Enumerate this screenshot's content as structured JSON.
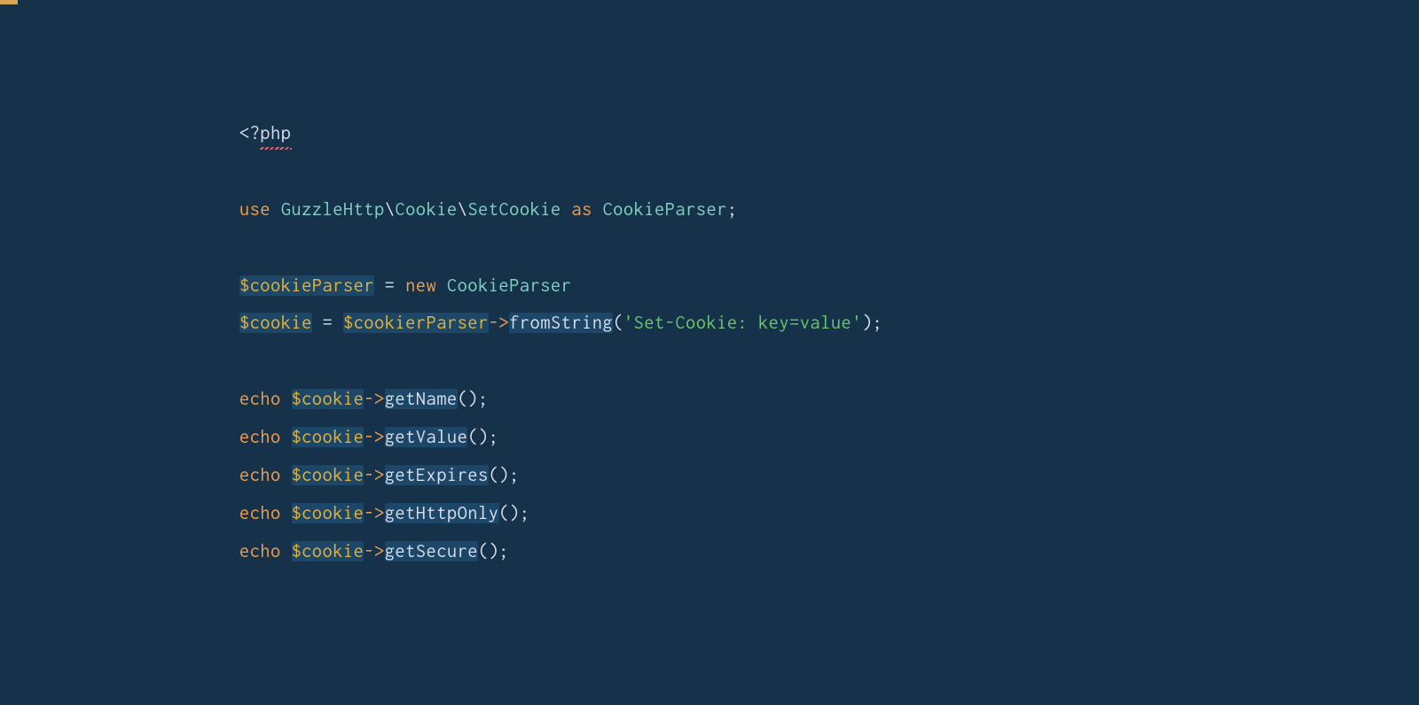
{
  "code": {
    "lines": [
      {
        "tokens": [
          {
            "text": "<?",
            "class": "token-default"
          },
          {
            "text": "php",
            "class": "token-default",
            "squiggle": true
          }
        ]
      },
      {
        "tokens": []
      },
      {
        "tokens": [
          {
            "text": "use",
            "class": "token-keyword"
          },
          {
            "text": " ",
            "class": "token-default"
          },
          {
            "text": "GuzzleHttp",
            "class": "token-class"
          },
          {
            "text": "\\",
            "class": "token-backslash"
          },
          {
            "text": "Cookie",
            "class": "token-class"
          },
          {
            "text": "\\",
            "class": "token-backslash"
          },
          {
            "text": "SetCookie",
            "class": "token-class"
          },
          {
            "text": " ",
            "class": "token-default"
          },
          {
            "text": "as",
            "class": "token-keyword"
          },
          {
            "text": " ",
            "class": "token-default"
          },
          {
            "text": "CookieParser",
            "class": "token-class"
          },
          {
            "text": ";",
            "class": "token-punct"
          }
        ]
      },
      {
        "tokens": []
      },
      {
        "tokens": [
          {
            "text": "$cookieParser",
            "class": "token-variable",
            "hl": true
          },
          {
            "text": " = ",
            "class": "token-operator"
          },
          {
            "text": "new",
            "class": "token-keyword"
          },
          {
            "text": " ",
            "class": "token-default"
          },
          {
            "text": "CookieParser",
            "class": "token-class"
          }
        ]
      },
      {
        "tokens": [
          {
            "text": "$cookie",
            "class": "token-variable",
            "hl": true
          },
          {
            "text": " = ",
            "class": "token-operator"
          },
          {
            "text": "$cookierParser",
            "class": "token-variable",
            "hl": true
          },
          {
            "text": "->",
            "class": "token-arrow"
          },
          {
            "text": "fromString",
            "class": "token-method",
            "hl": true
          },
          {
            "text": "(",
            "class": "token-punct"
          },
          {
            "text": "'Set-Cookie: key=value'",
            "class": "token-string"
          },
          {
            "text": ")",
            "class": "token-punct"
          },
          {
            "text": ";",
            "class": "token-punct"
          }
        ]
      },
      {
        "tokens": []
      },
      {
        "tokens": [
          {
            "text": "echo",
            "class": "token-keyword"
          },
          {
            "text": " ",
            "class": "token-default"
          },
          {
            "text": "$cookie",
            "class": "token-variable",
            "hl": true
          },
          {
            "text": "->",
            "class": "token-arrow"
          },
          {
            "text": "getName",
            "class": "token-method",
            "hl": true
          },
          {
            "text": "()",
            "class": "token-punct"
          },
          {
            "text": ";",
            "class": "token-punct"
          }
        ]
      },
      {
        "tokens": [
          {
            "text": "echo",
            "class": "token-keyword"
          },
          {
            "text": " ",
            "class": "token-default"
          },
          {
            "text": "$cookie",
            "class": "token-variable",
            "hl": true
          },
          {
            "text": "->",
            "class": "token-arrow"
          },
          {
            "text": "getValue",
            "class": "token-method",
            "hl": true
          },
          {
            "text": "()",
            "class": "token-punct"
          },
          {
            "text": ";",
            "class": "token-punct"
          }
        ]
      },
      {
        "tokens": [
          {
            "text": "echo",
            "class": "token-keyword"
          },
          {
            "text": " ",
            "class": "token-default"
          },
          {
            "text": "$cookie",
            "class": "token-variable",
            "hl": true
          },
          {
            "text": "->",
            "class": "token-arrow"
          },
          {
            "text": "getExpires",
            "class": "token-method",
            "hl": true
          },
          {
            "text": "()",
            "class": "token-punct"
          },
          {
            "text": ";",
            "class": "token-punct"
          }
        ]
      },
      {
        "tokens": [
          {
            "text": "echo",
            "class": "token-keyword"
          },
          {
            "text": " ",
            "class": "token-default"
          },
          {
            "text": "$cookie",
            "class": "token-variable",
            "hl": true
          },
          {
            "text": "->",
            "class": "token-arrow"
          },
          {
            "text": "getHttpOnly",
            "class": "token-method",
            "hl": true
          },
          {
            "text": "()",
            "class": "token-punct"
          },
          {
            "text": ";",
            "class": "token-punct"
          }
        ]
      },
      {
        "tokens": [
          {
            "text": "echo",
            "class": "token-keyword"
          },
          {
            "text": " ",
            "class": "token-default"
          },
          {
            "text": "$cookie",
            "class": "token-variable",
            "hl": true
          },
          {
            "text": "->",
            "class": "token-arrow"
          },
          {
            "text": "getSecure",
            "class": "token-method",
            "hl": true
          },
          {
            "text": "()",
            "class": "token-punct"
          },
          {
            "text": ";",
            "class": "token-punct"
          }
        ]
      }
    ]
  }
}
